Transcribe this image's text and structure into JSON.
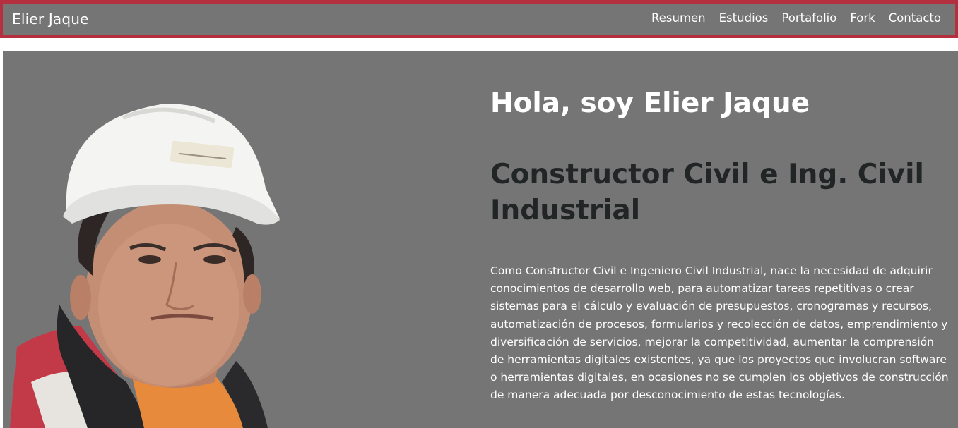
{
  "navbar": {
    "brand": "Elier Jaque",
    "links": [
      "Resumen",
      "Estudios",
      "Portafolio",
      "Fork",
      "Contacto"
    ]
  },
  "hero": {
    "greeting": "Hola, soy Elier Jaque",
    "profession": "Constructor Civil e Ing. Civil Industrial",
    "bio": "Como Constructor Civil e Ingeniero Civil Industrial, nace la necesidad de adquirir conocimientos de desarrollo web, para automatizar tareas repetitivas o crear sistemas para el cálculo y evaluación de presupuestos, cronogramas y recursos, automatización de procesos, formularios y recolección de datos, emprendimiento y diversificación de servicios, mejorar la competitividad, aumentar la comprensión de herramientas digitales existentes, ya que los proyectos que involucran software o herramientas digitales, en ocasiones no se cumplen los objetivos de construcción de manera adecuada por desconocimiento de estas tecnologías."
  },
  "colors": {
    "nav_border": "#b5303f",
    "panel_background": "#757575",
    "heading_dark": "#222526",
    "text_light": "#ffffff"
  }
}
